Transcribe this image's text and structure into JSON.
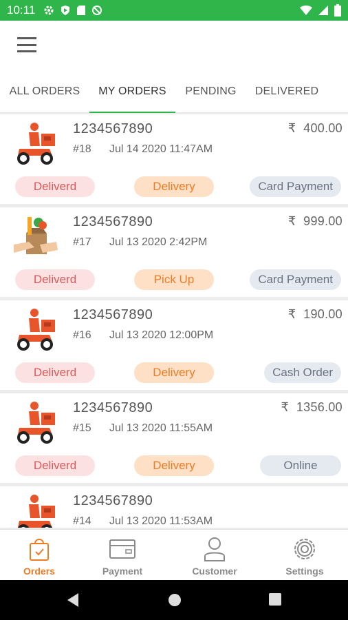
{
  "status_bar": {
    "time": "10:11"
  },
  "tabs": [
    {
      "label": "ALL ORDERS",
      "active": false
    },
    {
      "label": "MY ORDERS",
      "active": true
    },
    {
      "label": "PENDING",
      "active": false
    },
    {
      "label": "DELIVERED",
      "active": false
    }
  ],
  "orders": [
    {
      "phone": "1234567890",
      "number": "#18",
      "date": "Jul 14 2020 11:47AM",
      "currency": "₹",
      "amount": "400.00",
      "status": "Deliverd",
      "type": "Delivery",
      "payment": "Card Payment",
      "image": "delivery-scooter"
    },
    {
      "phone": "1234567890",
      "number": "#17",
      "date": "Jul 13 2020  2:42PM",
      "currency": "₹",
      "amount": "999.00",
      "status": "Deliverd",
      "type": "Pick Up",
      "payment": "Card Payment",
      "image": "grocery-bag"
    },
    {
      "phone": "1234567890",
      "number": "#16",
      "date": "Jul 13 2020 12:00PM",
      "currency": "₹",
      "amount": "190.00",
      "status": "Deliverd",
      "type": "Delivery",
      "payment": "Cash Order",
      "image": "delivery-scooter"
    },
    {
      "phone": "1234567890",
      "number": "#15",
      "date": "Jul 13 2020 11:55AM",
      "currency": "₹",
      "amount": "1356.00",
      "status": "Deliverd",
      "type": "Delivery",
      "payment": "Online",
      "image": "delivery-scooter"
    },
    {
      "phone": "1234567890",
      "number": "#14",
      "date": "Jul 13 2020 11:53AM",
      "currency": "",
      "amount": "",
      "status": "",
      "type": "",
      "payment": "",
      "image": "delivery-scooter"
    }
  ],
  "bottom_nav": [
    {
      "label": "Orders",
      "icon": "shopping-bag-icon",
      "active": true
    },
    {
      "label": "Payment",
      "icon": "card-icon",
      "active": false
    },
    {
      "label": "Customer",
      "icon": "person-icon",
      "active": false
    },
    {
      "label": "Settings",
      "icon": "gear-icon",
      "active": false
    }
  ],
  "colors": {
    "accent_green": "#2fb54a",
    "accent_orange": "#ef7b23",
    "status_red": "#d95a5a"
  }
}
